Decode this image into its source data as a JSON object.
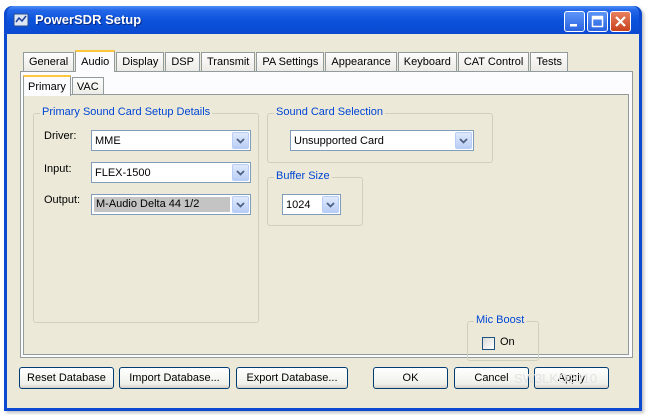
{
  "window": {
    "title": "PowerSDR Setup"
  },
  "tabs": [
    {
      "label": "General"
    },
    {
      "label": "Audio"
    },
    {
      "label": "Display"
    },
    {
      "label": "DSP"
    },
    {
      "label": "Transmit"
    },
    {
      "label": "PA Settings"
    },
    {
      "label": "Appearance"
    },
    {
      "label": "Keyboard"
    },
    {
      "label": "CAT Control"
    },
    {
      "label": "Tests"
    }
  ],
  "active_tab": "Audio",
  "subtabs": [
    {
      "label": "Primary"
    },
    {
      "label": "VAC"
    }
  ],
  "active_subtab": "Primary",
  "primary_group": {
    "title": "Primary Sound Card Setup Details",
    "driver": {
      "label": "Driver:",
      "value": "MME"
    },
    "input": {
      "label": "Input:",
      "value": "FLEX-1500"
    },
    "output": {
      "label": "Output:",
      "value": "M-Audio Delta 44 1/2"
    }
  },
  "sound_card_group": {
    "title": "Sound Card Selection",
    "value": "Unsupported Card"
  },
  "buffer_group": {
    "title": "Buffer Size",
    "value": "1024"
  },
  "mic_boost_group": {
    "title": "Mic Boost",
    "checkbox_label": "On",
    "checked": false
  },
  "buttons": {
    "reset": "Reset Database",
    "import": "Import Database...",
    "export": "Export Database...",
    "ok": "OK",
    "cancel": "Cancel",
    "apply": "Apply"
  },
  "watermark": "SW3LKO2010"
}
